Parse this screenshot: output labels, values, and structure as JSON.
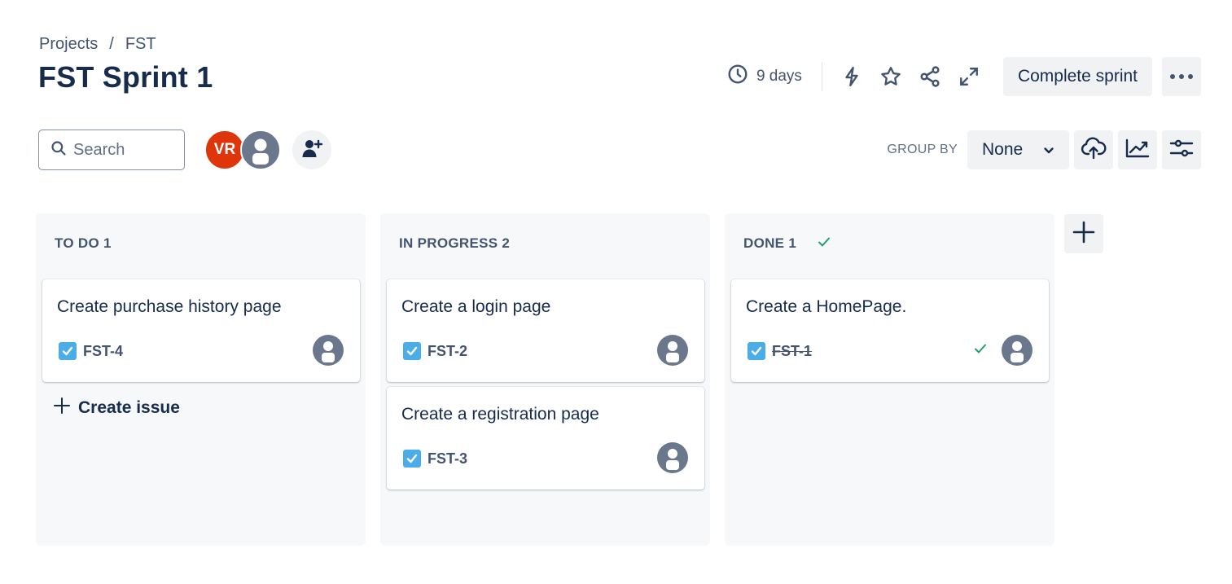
{
  "breadcrumb": {
    "projects": "Projects",
    "separator": "/",
    "project": "FST"
  },
  "page_title": "FST Sprint 1",
  "header": {
    "days_remaining": "9 days",
    "complete_label": "Complete sprint",
    "icons": [
      "clock-icon",
      "lightning-icon",
      "star-icon",
      "share-icon",
      "expand-icon",
      "more-icon"
    ]
  },
  "toolbar": {
    "search_placeholder": "Search",
    "avatar_initials": "VR",
    "group_by_label": "GROUP BY",
    "group_by_value": "None"
  },
  "columns": [
    {
      "title": "TO DO 1",
      "cards": [
        {
          "title": "Create purchase history page",
          "key": "FST-4"
        }
      ],
      "create_label": "Create issue"
    },
    {
      "title": "IN PROGRESS 2",
      "cards": [
        {
          "title": "Create a login page",
          "key": "FST-2"
        },
        {
          "title": "Create a registration page",
          "key": "FST-3"
        }
      ]
    },
    {
      "title": "DONE 1",
      "cards": [
        {
          "title": "Create a HomePage.",
          "key": "FST-1"
        }
      ]
    }
  ],
  "colors": {
    "text": "#172b4d",
    "subtle": "#44546f",
    "avatar_vr": "#de350b",
    "checkbox": "#4bade8",
    "done_check": "#22a06b",
    "column_bg": "#f7f8f9",
    "button_bg": "#f1f2f4"
  }
}
